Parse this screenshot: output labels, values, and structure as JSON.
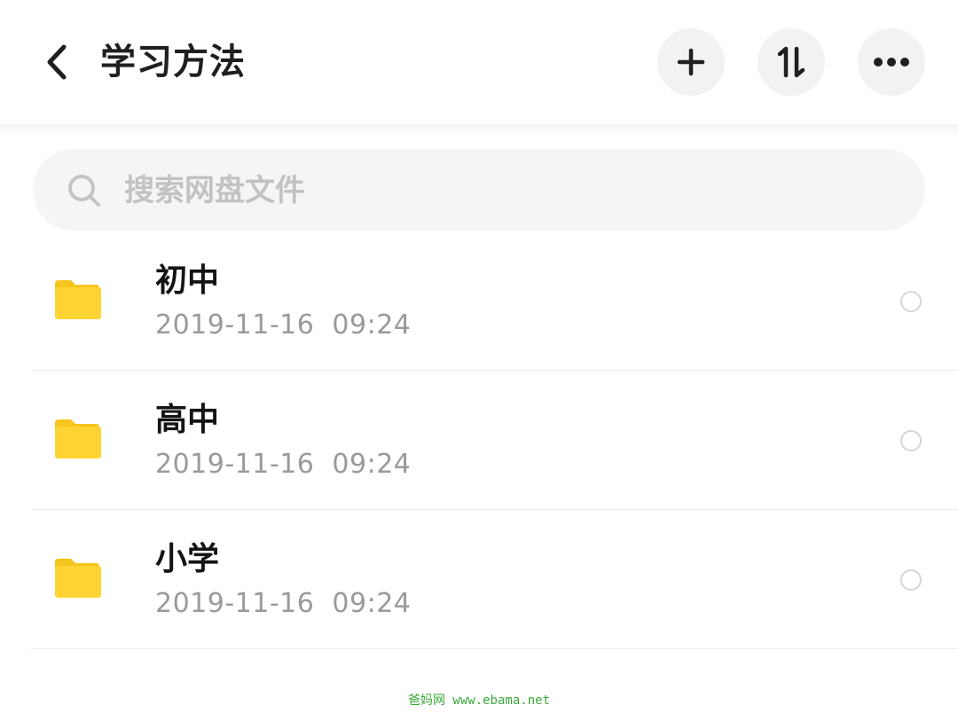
{
  "header": {
    "title": "学习方法",
    "back_icon": "back-chevron-icon",
    "actions": [
      {
        "name": "add",
        "icon": "plus-icon"
      },
      {
        "name": "sort",
        "icon": "sort-icon"
      },
      {
        "name": "more",
        "icon": "more-dots-icon"
      }
    ]
  },
  "search": {
    "placeholder": "搜索网盘文件",
    "value": "",
    "icon": "search-icon"
  },
  "files": [
    {
      "name": "初中",
      "modified": "2019-11-16  09:24",
      "type": "folder",
      "selected": false
    },
    {
      "name": "高中",
      "modified": "2019-11-16  09:24",
      "type": "folder",
      "selected": false
    },
    {
      "name": "小学",
      "modified": "2019-11-16  09:24",
      "type": "folder",
      "selected": false
    }
  ],
  "watermark": "爸妈网 www.ebama.net",
  "colors": {
    "folder": "#FFD333",
    "folder_tab": "#F5C51E",
    "title_text": "#1f1f1f",
    "secondary_text": "#9a9a9a",
    "button_bg": "#f2f2f2",
    "watermark": "#3aaa3a"
  }
}
